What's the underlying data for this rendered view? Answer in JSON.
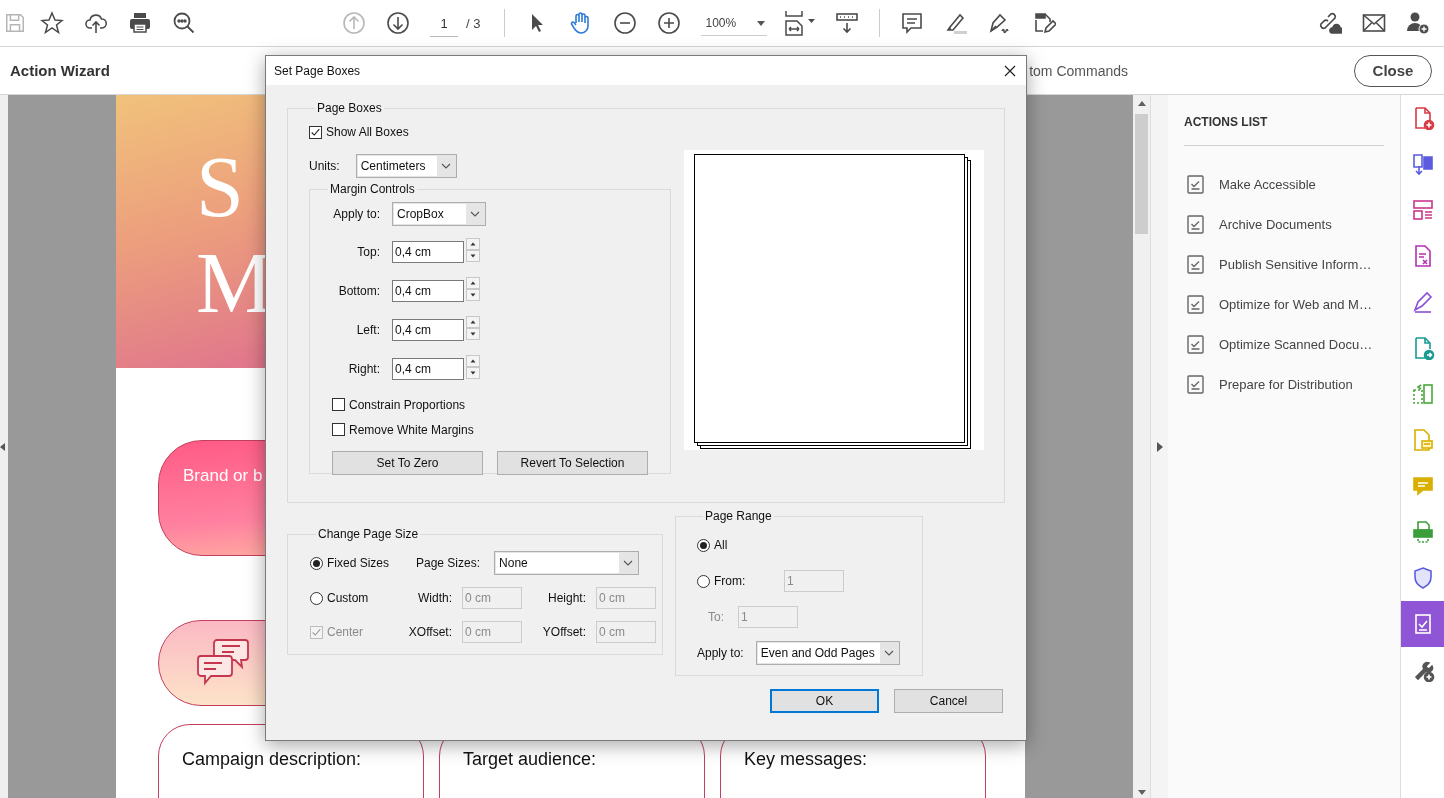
{
  "toolbar": {
    "save_disabled": true,
    "previous_page_disabled": true,
    "page_number": "1",
    "page_count": "/ 3",
    "tools": [
      {
        "kind": "select",
        "selected": false
      },
      {
        "kind": "hand",
        "selected": true
      }
    ],
    "zoom": "100%"
  },
  "header": {
    "title": "Action Wizard",
    "partial_label": "tom Commands",
    "close_button": "Close"
  },
  "document": {
    "hero_letters": [
      "S",
      "M"
    ],
    "banner_text": "Brand or b",
    "boxes": [
      "Campaign description:",
      "Target audience:",
      "Key messages:"
    ]
  },
  "dialog": {
    "title": "Set Page Boxes",
    "page_boxes": {
      "legend": "Page Boxes",
      "show_all": {
        "label": "Show All Boxes",
        "checked": true
      },
      "units": {
        "label": "Units:",
        "value": "Centimeters"
      },
      "margin_controls": {
        "legend": "Margin Controls",
        "apply_to": {
          "label": "Apply to:",
          "value": "CropBox"
        },
        "margins": [
          {
            "label": "Top:",
            "value": "0,4 cm"
          },
          {
            "label": "Bottom:",
            "value": "0,4 cm"
          },
          {
            "label": "Left:",
            "value": "0,4 cm"
          },
          {
            "label": "Right:",
            "value": "0,4 cm"
          }
        ],
        "options": [
          {
            "label": "Constrain Proportions",
            "checked": false
          },
          {
            "label": "Remove White Margins",
            "checked": false
          }
        ],
        "buttons": [
          "Set To Zero",
          "Revert To Selection"
        ]
      }
    },
    "change_page_size": {
      "legend": "Change Page Size",
      "modes": [
        {
          "label": "Fixed Sizes",
          "selected": true
        },
        {
          "label": "Custom",
          "selected": false
        }
      ],
      "page_sizes": {
        "label": "Page Sizes:",
        "value": "None"
      },
      "center": {
        "label": "Center",
        "checked": true,
        "disabled": true
      },
      "fields": [
        {
          "label": "Width:",
          "value": "0 cm",
          "disabled": true
        },
        {
          "label": "Height:",
          "value": "0 cm",
          "disabled": true
        },
        {
          "label": "XOffset:",
          "value": "0 cm",
          "disabled": true
        },
        {
          "label": "YOffset:",
          "value": "0 cm",
          "disabled": true
        }
      ]
    },
    "page_range": {
      "legend": "Page Range",
      "modes": [
        {
          "label": "All",
          "selected": true
        },
        {
          "label": "From:",
          "selected": false
        }
      ],
      "from": {
        "value": "1",
        "disabled": true
      },
      "to": {
        "label": "To:",
        "value": "1",
        "disabled": true
      },
      "apply_to": {
        "label": "Apply to:",
        "value": "Even and Odd Pages"
      }
    },
    "buttons": [
      {
        "label": "OK",
        "default": true
      },
      {
        "label": "Cancel",
        "default": false
      }
    ]
  },
  "actions_panel": {
    "heading": "ACTIONS LIST",
    "actions": [
      "Make Accessible",
      "Archive Documents",
      "Publish Sensitive Inform…",
      "Optimize for Web and M…",
      "Optimize Scanned Docu…",
      "Prepare for Distribution"
    ]
  },
  "tools_column": [
    {
      "kind": "create",
      "selected": false
    },
    {
      "kind": "export",
      "selected": false
    },
    {
      "kind": "layout",
      "selected": false
    },
    {
      "kind": "redact",
      "selected": false
    },
    {
      "kind": "sign",
      "selected": false
    },
    {
      "kind": "send",
      "selected": false
    },
    {
      "kind": "compare",
      "selected": false
    },
    {
      "kind": "review",
      "selected": false
    },
    {
      "kind": "comment",
      "selected": false
    },
    {
      "kind": "print",
      "selected": false
    },
    {
      "kind": "protect",
      "selected": false
    },
    {
      "kind": "actions",
      "selected": true
    },
    {
      "kind": "more",
      "selected": false
    }
  ]
}
